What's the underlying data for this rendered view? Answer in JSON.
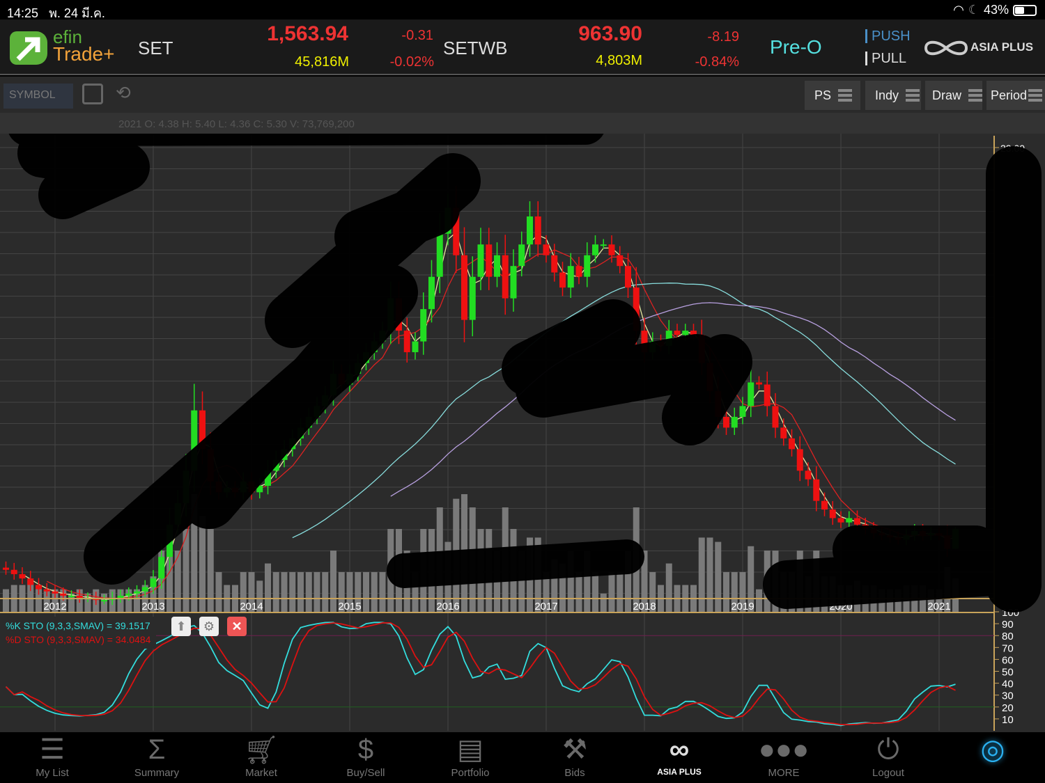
{
  "status_bar": {
    "time": "14:25",
    "date": "พ. 24 มี.ค.",
    "battery": "43%",
    "battery_level": 0.43
  },
  "header": {
    "logo_top": "efin",
    "logo_bottom": "Trade+",
    "index1": {
      "name": "SET",
      "value": "1,563.94",
      "volume": "45,816M",
      "change": "-0.31",
      "percent": "-0.02%"
    },
    "index2": {
      "name": "SETWB",
      "value": "963.90",
      "volume": "4,803M",
      "change": "-8.19",
      "percent": "-0.84%"
    },
    "session": "Pre-O",
    "push": "PUSH",
    "pull": "PULL",
    "broker": "ASIA PLUS"
  },
  "toolbar": {
    "symbol_placeholder": "SYMBOL",
    "buttons": [
      "PS",
      "Indy",
      "Draw",
      "Period"
    ]
  },
  "ohlc_info": "2021 O: 4.38   H: 5.40   L: 4.36   C: 5.30   V: 73,769,200",
  "indicator": {
    "k_label": "%K STO (9,3,3,SMAV) = 39.1517",
    "d_label": "%D STO (9,3,3,SMAV) = 34.0484"
  },
  "colors": {
    "up": "#22dd22",
    "down": "#ee1111",
    "k": "#33dddd",
    "d": "#dd1111",
    "axis": "#c8a35a"
  },
  "chart_data": {
    "type": "candlestick",
    "period": "monthly",
    "start": "2011-07",
    "closes": [
      3.4,
      3.2,
      3.0,
      2.7,
      2.5,
      2.4,
      2.3,
      2.2,
      2.2,
      2.1,
      2.1,
      2.0,
      2.0,
      2.1,
      2.2,
      2.3,
      2.4,
      2.6,
      3.0,
      4.0,
      5.5,
      6.5,
      8.0,
      10.8,
      9.0,
      7.5,
      7.0,
      7.2,
      7.0,
      7.5,
      7.0,
      7.3,
      8.0,
      8.5,
      9.0,
      9.5,
      10.0,
      10.5,
      11.0,
      11.5,
      12.5,
      12.0,
      12.5,
      13.0,
      13.5,
      14.0,
      14.5,
      16.0,
      14.5,
      13.5,
      14.0,
      15.5,
      17.0,
      19.0,
      20.2,
      18.0,
      15.0,
      17.0,
      18.5,
      17.0,
      18.0,
      16.0,
      17.5,
      18.5,
      19.8,
      18.5,
      18.0,
      17.2,
      16.5,
      17.5,
      17.0,
      18.0,
      18.5,
      18.5,
      18.0,
      17.5,
      16.5,
      14.5,
      13.5,
      14.0,
      13.8,
      14.5,
      14.3,
      14.5,
      14.3,
      13.0,
      11.7,
      10.5,
      10.0,
      10.5,
      11.0,
      12.1,
      12.0,
      11.0,
      10.0,
      9.5,
      9.0,
      8.0,
      7.6,
      6.6,
      6.2,
      5.8,
      5.6,
      5.8,
      5.5,
      5.3,
      5.1,
      5.0,
      4.9,
      4.8,
      5.0,
      5.2,
      5.0,
      5.1,
      5.0,
      4.38,
      5.3
    ],
    "last_candle": {
      "open": 4.38,
      "high": 5.4,
      "low": 4.36,
      "close": 5.3
    },
    "x_ticks": [
      "2012",
      "2013",
      "2014",
      "2015",
      "2016",
      "2017",
      "2018",
      "2019",
      "2020",
      "2021"
    ],
    "y_price_label": "23.00",
    "stoch_ticks": [
      "100",
      "90",
      "80",
      "70",
      "60",
      "50",
      "40",
      "30",
      "20",
      "10"
    ],
    "stoch_levels": {
      "overbought": 80,
      "oversold": 20
    },
    "stoch_last": {
      "k": 39.1517,
      "d": 34.0484
    }
  },
  "nav": [
    "My List",
    "Summary",
    "Market",
    "Buy/Sell",
    "Portfolio",
    "Bids",
    "ASIA PLUS",
    "MORE",
    "Logout"
  ]
}
